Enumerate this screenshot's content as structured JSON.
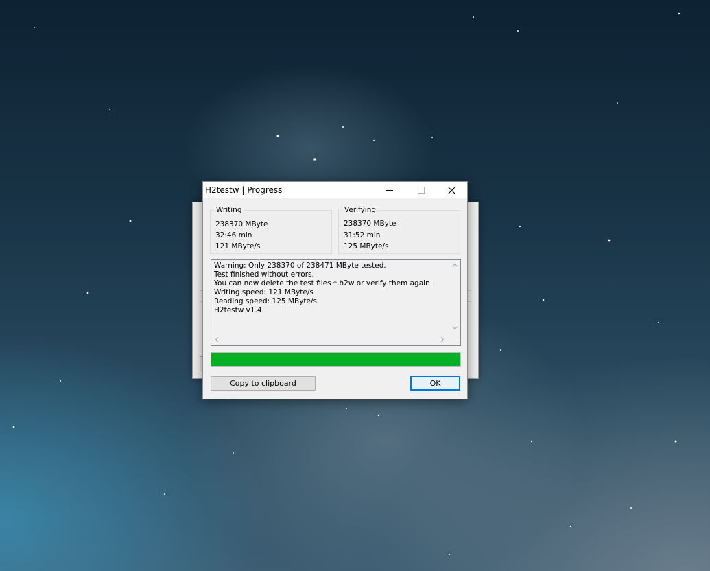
{
  "window": {
    "title": "H2testw | Progress"
  },
  "writing": {
    "label": "Writing",
    "amount": "238370 MByte",
    "time": "32:46 min",
    "speed": "121 MByte/s"
  },
  "verifying": {
    "label": "Verifying",
    "amount": "238370 MByte",
    "time": "31:52 min",
    "speed": "125 MByte/s"
  },
  "log": {
    "lines": [
      "Warning: Only 238370 of 238471 MByte tested.",
      "Test finished without errors.",
      "You can now delete the test files *.h2w or verify them again.",
      "Writing speed: 121 MByte/s",
      "Reading speed: 125 MByte/s",
      "H2testw v1.4"
    ]
  },
  "progress": {
    "fraction": 1.0,
    "color": "#06b025"
  },
  "buttons": {
    "copy_label": "Copy to clipboard",
    "ok_label": "OK"
  },
  "icons": [
    "minimize-icon",
    "maximize-icon",
    "close-icon",
    "scroll-up-icon",
    "scroll-down-icon",
    "scroll-left-icon",
    "scroll-right-icon"
  ],
  "colors": {
    "accent": "#0078d7",
    "progress": "#06b025"
  }
}
